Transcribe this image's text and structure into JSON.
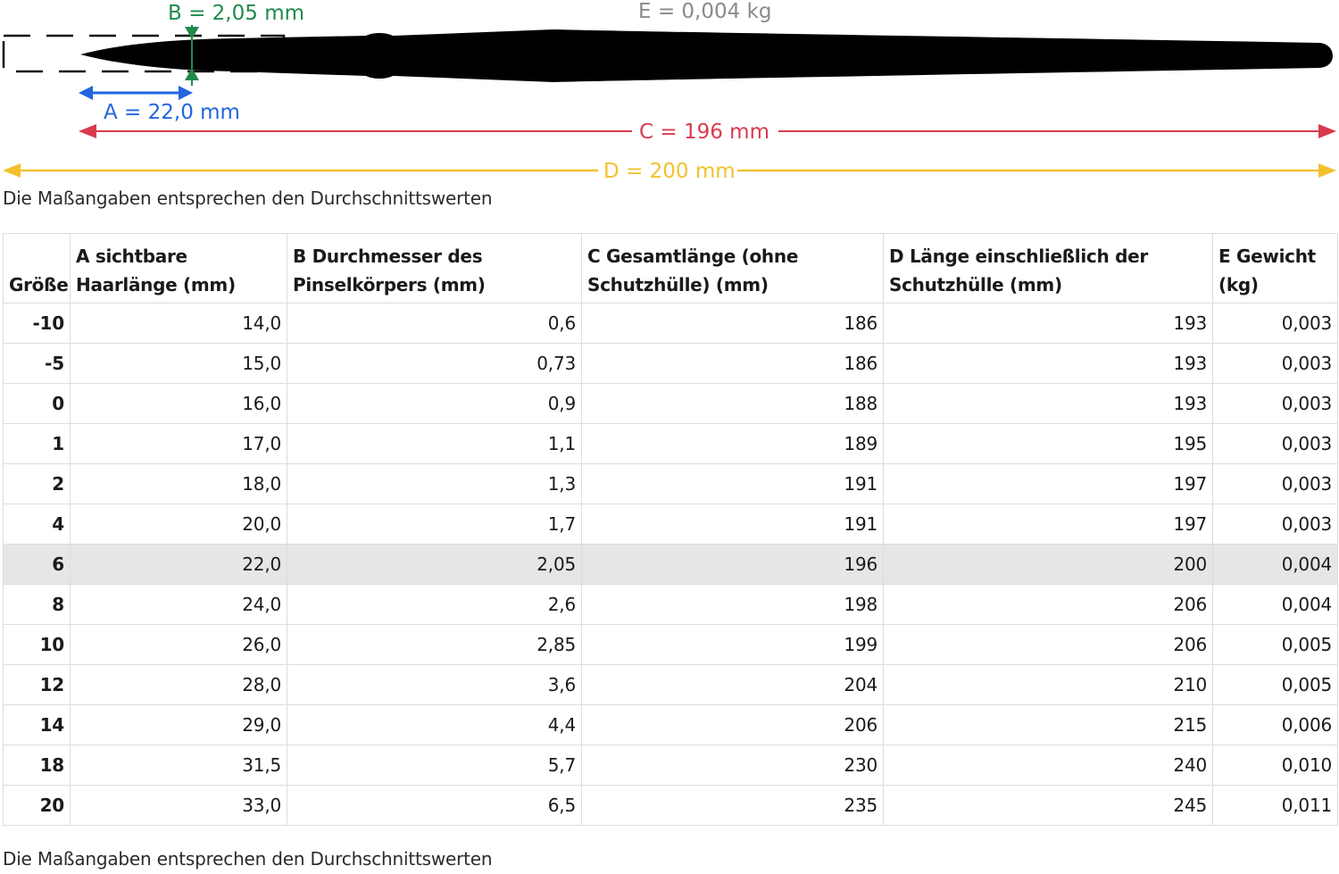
{
  "diagram": {
    "label_b": "B = 2,05 mm",
    "label_e": "E = 0,004 kg",
    "label_a": "A = 22,0 mm",
    "label_c": "C = 196 mm",
    "label_d": "D = 200 mm",
    "colors": {
      "a": "#2266dd",
      "b": "#1f8a4c",
      "c": "#d93a4f",
      "d": "#f2c12e",
      "e": "#8a8a8a",
      "brush": "#000000"
    }
  },
  "note": "Die Maßangaben entsprechen den Durchschnittswerten",
  "table": {
    "headers": [
      "Größe",
      "A sichtbare Haarlänge (mm)",
      "B Durchmesser des Pinselkörpers (mm)",
      "C Gesamtlänge (ohne Schutzhülle) (mm)",
      "D Länge einschließlich der Schutzhülle (mm)",
      "E Gewicht (kg)"
    ],
    "highlighted_size": "6",
    "rows": [
      [
        "-10",
        "14,0",
        "0,6",
        "186",
        "193",
        "0,003"
      ],
      [
        "-5",
        "15,0",
        "0,73",
        "186",
        "193",
        "0,003"
      ],
      [
        "0",
        "16,0",
        "0,9",
        "188",
        "193",
        "0,003"
      ],
      [
        "1",
        "17,0",
        "1,1",
        "189",
        "195",
        "0,003"
      ],
      [
        "2",
        "18,0",
        "1,3",
        "191",
        "197",
        "0,003"
      ],
      [
        "4",
        "20,0",
        "1,7",
        "191",
        "197",
        "0,003"
      ],
      [
        "6",
        "22,0",
        "2,05",
        "196",
        "200",
        "0,004"
      ],
      [
        "8",
        "24,0",
        "2,6",
        "198",
        "206",
        "0,004"
      ],
      [
        "10",
        "26,0",
        "2,85",
        "199",
        "206",
        "0,005"
      ],
      [
        "12",
        "28,0",
        "3,6",
        "204",
        "210",
        "0,005"
      ],
      [
        "14",
        "29,0",
        "4,4",
        "206",
        "215",
        "0,006"
      ],
      [
        "18",
        "31,5",
        "5,7",
        "230",
        "240",
        "0,010"
      ],
      [
        "20",
        "33,0",
        "6,5",
        "235",
        "245",
        "0,011"
      ]
    ]
  }
}
